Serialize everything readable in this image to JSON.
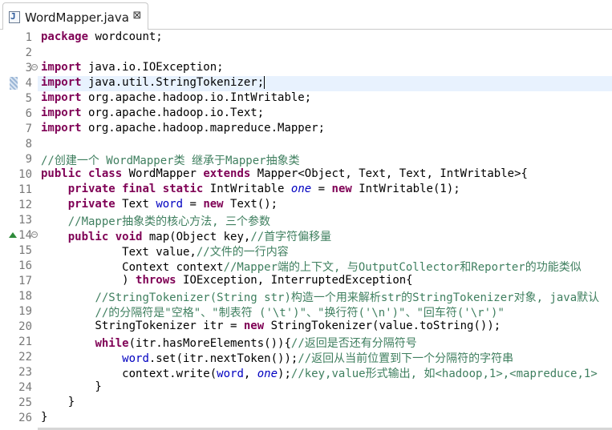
{
  "tab": {
    "title": "WordMapper.java",
    "icon": "java-file-icon",
    "close_glyph": "⊠"
  },
  "colors": {
    "keyword": "#7f0055",
    "field": "#0000c0",
    "comment": "#3f7f5f",
    "current_line": "#e8f2fe"
  },
  "editor": {
    "line_numbers": [
      "1",
      "2",
      "3",
      "4",
      "5",
      "6",
      "7",
      "8",
      "9",
      "10",
      "11",
      "12",
      "13",
      "14",
      "15",
      "16",
      "17",
      "18",
      "19",
      "20",
      "21",
      "22",
      "23",
      "24",
      "25",
      "26"
    ],
    "current_line": 4,
    "lines": [
      [
        {
          "t": "package",
          "c": "kw"
        },
        {
          "t": " wordcount;"
        }
      ],
      [],
      [
        {
          "t": "import",
          "c": "kw"
        },
        {
          "t": " java.io.IOException;"
        }
      ],
      [
        {
          "t": "import",
          "c": "kw"
        },
        {
          "t": " java.util.StringTokenizer;"
        }
      ],
      [
        {
          "t": "import",
          "c": "kw"
        },
        {
          "t": " org.apache.hadoop.io.IntWritable;"
        }
      ],
      [
        {
          "t": "import",
          "c": "kw"
        },
        {
          "t": " org.apache.hadoop.io.Text;"
        }
      ],
      [
        {
          "t": "import",
          "c": "kw"
        },
        {
          "t": " org.apache.hadoop.mapreduce.Mapper;"
        }
      ],
      [],
      [
        {
          "t": "//创建一个 WordMapper类 继承于Mapper抽象类",
          "c": "cm"
        }
      ],
      [
        {
          "t": "public",
          "c": "kw"
        },
        {
          "t": " "
        },
        {
          "t": "class",
          "c": "kw"
        },
        {
          "t": " WordMapper "
        },
        {
          "t": "extends",
          "c": "kw"
        },
        {
          "t": " Mapper<Object, Text, Text, IntWritable>{"
        }
      ],
      [
        {
          "t": "    "
        },
        {
          "t": "private",
          "c": "kw"
        },
        {
          "t": " "
        },
        {
          "t": "final",
          "c": "kw"
        },
        {
          "t": " "
        },
        {
          "t": "static",
          "c": "kw"
        },
        {
          "t": " IntWritable "
        },
        {
          "t": "one",
          "c": "fld-it"
        },
        {
          "t": " = "
        },
        {
          "t": "new",
          "c": "kw"
        },
        {
          "t": " IntWritable(1);"
        }
      ],
      [
        {
          "t": "    "
        },
        {
          "t": "private",
          "c": "kw"
        },
        {
          "t": " Text "
        },
        {
          "t": "word",
          "c": "fld"
        },
        {
          "t": " = "
        },
        {
          "t": "new",
          "c": "kw"
        },
        {
          "t": " Text();"
        }
      ],
      [
        {
          "t": "    "
        },
        {
          "t": "//Mapper抽象类的核心方法, 三个参数",
          "c": "cm"
        }
      ],
      [
        {
          "t": "    "
        },
        {
          "t": "public",
          "c": "kw"
        },
        {
          "t": " "
        },
        {
          "t": "void",
          "c": "kw"
        },
        {
          "t": " map(Object key,"
        },
        {
          "t": "//首字符偏移量",
          "c": "cm"
        }
      ],
      [
        {
          "t": "            Text value,"
        },
        {
          "t": "//文件的一行内容",
          "c": "cm"
        }
      ],
      [
        {
          "t": "            Context context"
        },
        {
          "t": "//Mapper端的上下文, 与OutputCollector和Reporter的功能类似",
          "c": "cm"
        }
      ],
      [
        {
          "t": "            ) "
        },
        {
          "t": "throws",
          "c": "kw"
        },
        {
          "t": " IOException, InterruptedException{"
        }
      ],
      [
        {
          "t": "        "
        },
        {
          "t": "//StringTokenizer(String str)构造一个用来解析str的StringTokenizer对象, java默认",
          "c": "cm"
        }
      ],
      [
        {
          "t": "        "
        },
        {
          "t": "//的分隔符是\"空格\"、\"制表符 ('\\t')\"、\"换行符('\\n')\"、\"回车符('\\r')\"",
          "c": "cm"
        }
      ],
      [
        {
          "t": "        StringTokenizer itr = "
        },
        {
          "t": "new",
          "c": "kw"
        },
        {
          "t": " StringTokenizer(value.toString());"
        }
      ],
      [
        {
          "t": "        "
        },
        {
          "t": "while",
          "c": "kw"
        },
        {
          "t": "(itr.hasMoreElements()){"
        },
        {
          "t": "//返回是否还有分隔符号",
          "c": "cm"
        }
      ],
      [
        {
          "t": "            "
        },
        {
          "t": "word",
          "c": "fld"
        },
        {
          "t": ".set(itr.nextToken());"
        },
        {
          "t": "//返回从当前位置到下一个分隔符的字符串",
          "c": "cm"
        }
      ],
      [
        {
          "t": "            context.write("
        },
        {
          "t": "word",
          "c": "fld"
        },
        {
          "t": ", "
        },
        {
          "t": "one",
          "c": "fld-it"
        },
        {
          "t": ");"
        },
        {
          "t": "//key,value形式输出, 如<hadoop,1>,<mapreduce,1>",
          "c": "cm"
        }
      ],
      [
        {
          "t": "        }"
        }
      ],
      [
        {
          "t": "    }"
        }
      ],
      [
        {
          "t": "}"
        }
      ]
    ]
  }
}
